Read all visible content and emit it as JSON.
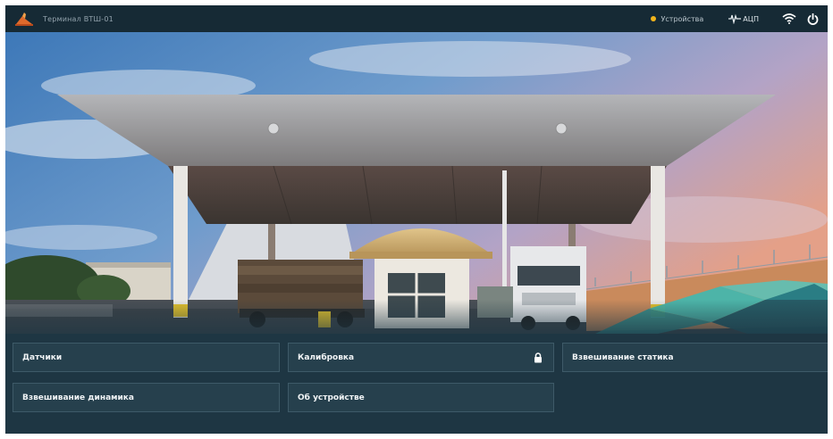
{
  "topbar": {
    "title": "Терминал ВТШ-01",
    "status_label": "Устройства",
    "adc_label": "АЦП",
    "icons": [
      "logo-icon",
      "status-dot-icon",
      "signal-icon",
      "wifi-icon",
      "power-icon"
    ],
    "status_color": "#f2b51c"
  },
  "menu": {
    "items": [
      {
        "label": "Датчики",
        "locked": false
      },
      {
        "label": "Калибровка",
        "locked": true
      },
      {
        "label": "Взвешивание статика",
        "locked": false
      },
      {
        "label": "Взвешивание динамика",
        "locked": false
      },
      {
        "label": "Об устройстве",
        "locked": false
      }
    ]
  },
  "colors": {
    "background": "#1c3340",
    "topbar": "#162a35",
    "button": "#26404d",
    "button_border": "#3e5a68",
    "accent": "#3fb8b0"
  }
}
